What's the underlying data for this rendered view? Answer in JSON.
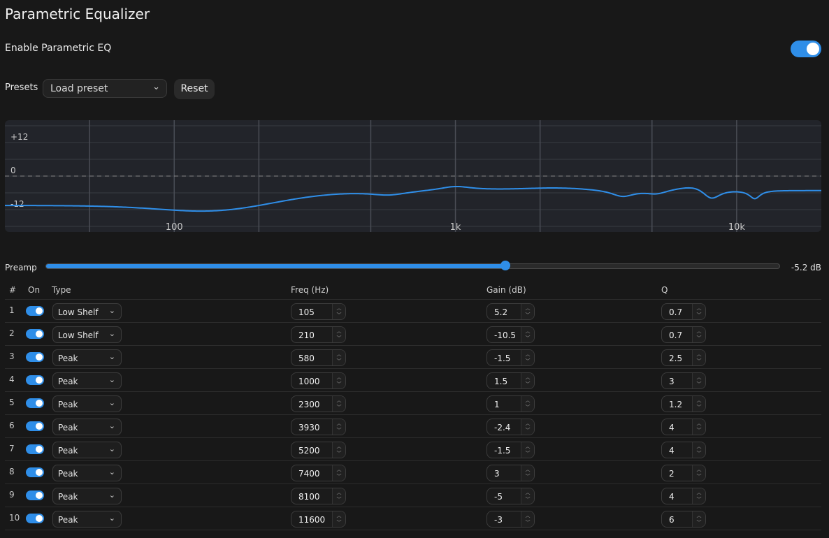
{
  "title": "Parametric Equalizer",
  "enable": {
    "label": "Enable Parametric EQ",
    "on": true
  },
  "presets": {
    "label": "Presets",
    "selected": "Load preset",
    "reset_label": "Reset"
  },
  "graph": {
    "y_labels": [
      "+12",
      "0",
      "-12"
    ],
    "x_labels": [
      "100",
      "1k",
      "10k"
    ],
    "freq_range": [
      25,
      20000
    ],
    "gain_range": [
      -20,
      20
    ]
  },
  "preamp": {
    "label": "Preamp",
    "value": -5.2,
    "value_text": "-5.2 dB",
    "min": -24,
    "max": 6
  },
  "table": {
    "headers": {
      "index": "#",
      "on": "On",
      "type": "Type",
      "freq": "Freq (Hz)",
      "gain": "Gain (dB)",
      "q": "Q"
    },
    "bands": [
      {
        "index": "1",
        "on": true,
        "type": "Low Shelf",
        "freq": "105",
        "gain": "5.2",
        "q": "0.7"
      },
      {
        "index": "2",
        "on": true,
        "type": "Low Shelf",
        "freq": "210",
        "gain": "-10.5",
        "q": "0.7"
      },
      {
        "index": "3",
        "on": true,
        "type": "Peak",
        "freq": "580",
        "gain": "-1.5",
        "q": "2.5"
      },
      {
        "index": "4",
        "on": true,
        "type": "Peak",
        "freq": "1000",
        "gain": "1.5",
        "q": "3"
      },
      {
        "index": "5",
        "on": true,
        "type": "Peak",
        "freq": "2300",
        "gain": "1",
        "q": "1.2"
      },
      {
        "index": "6",
        "on": true,
        "type": "Peak",
        "freq": "3930",
        "gain": "-2.4",
        "q": "4"
      },
      {
        "index": "7",
        "on": true,
        "type": "Peak",
        "freq": "5200",
        "gain": "-1.5",
        "q": "4"
      },
      {
        "index": "8",
        "on": true,
        "type": "Peak",
        "freq": "7400",
        "gain": "3",
        "q": "2"
      },
      {
        "index": "9",
        "on": true,
        "type": "Peak",
        "freq": "8100",
        "gain": "-5",
        "q": "4"
      },
      {
        "index": "10",
        "on": true,
        "type": "Peak",
        "freq": "11600",
        "gain": "-3",
        "q": "6"
      }
    ]
  },
  "colors": {
    "accent": "#2f8ee8",
    "background": "#181818",
    "graph_bg": "#22242a"
  }
}
